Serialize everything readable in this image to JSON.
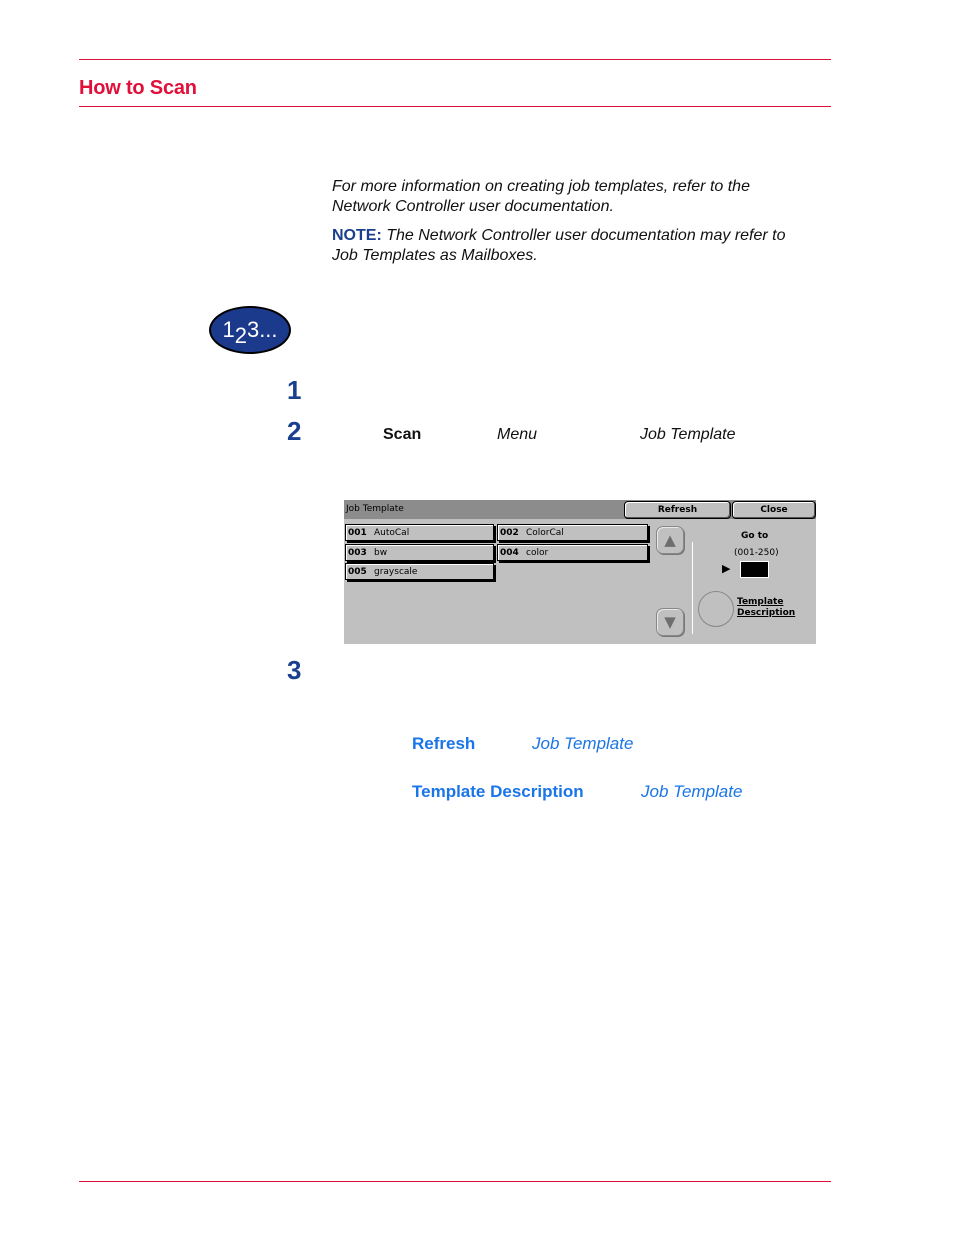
{
  "header": {
    "title": "How to Scan"
  },
  "intro": {
    "paragraph": [
      "For more information on creating job templates, refer to the",
      "Network Controller user documentation."
    ],
    "note_label": "NOTE:",
    "note_text": [
      "The Network Controller user documentation may refer to",
      "Job Templates as Mailboxes."
    ]
  },
  "steps_badge": {
    "digit1": "1",
    "digit2": "2",
    "rest": "3..."
  },
  "steps": [
    {
      "number": "1"
    },
    {
      "number": "2",
      "words": {
        "scan": "Scan",
        "menu": "Menu",
        "job_template": "Job Template"
      }
    },
    {
      "number": "3"
    }
  ],
  "panel": {
    "title": "Job Template",
    "refresh_label": "Refresh",
    "close_label": "Close",
    "templates": [
      {
        "num": "001",
        "name": "AutoCal"
      },
      {
        "num": "002",
        "name": "ColorCal"
      },
      {
        "num": "003",
        "name": "bw"
      },
      {
        "num": "004",
        "name": "color"
      },
      {
        "num": "005",
        "name": "grayscale"
      }
    ],
    "scroll_up_icon": "▲",
    "scroll_down_icon": "▼",
    "goto_label": "Go to",
    "goto_range": "(001-250)",
    "goto_arrow": "▶",
    "goto_value": "",
    "description_line1": "Template",
    "description_line2": "Description"
  },
  "options": [
    {
      "label": "Refresh",
      "context": "Job Template"
    },
    {
      "label": "Template Description",
      "context": "Job Template"
    }
  ]
}
